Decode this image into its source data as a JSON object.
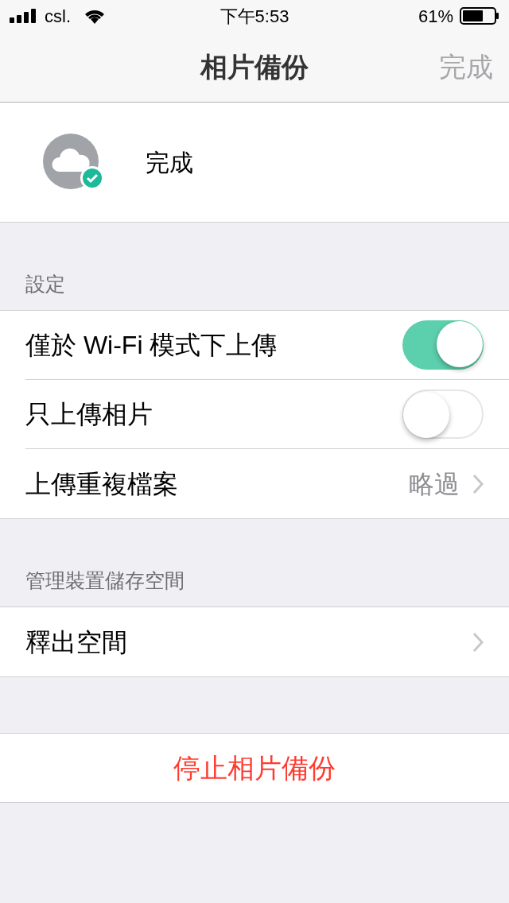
{
  "status_bar": {
    "carrier": "csl.",
    "time": "下午5:53",
    "battery": "61%"
  },
  "nav": {
    "title": "相片備份",
    "action": {
      "label": "完成",
      "disabled": true
    }
  },
  "status_card": {
    "text": "完成"
  },
  "sections": [
    {
      "header": "設定",
      "rows": [
        {
          "kind": "toggle",
          "label": "僅於 Wi-Fi 模式下上傳",
          "on": true
        },
        {
          "kind": "toggle",
          "label": "只上傳相片",
          "on": false
        },
        {
          "kind": "link",
          "label": "上傳重複檔案",
          "value": "略過"
        }
      ]
    },
    {
      "header": "管理裝置儲存空間",
      "rows": [
        {
          "kind": "link",
          "label": "釋出空間"
        }
      ]
    }
  ],
  "stop_button": "停止相片備份"
}
